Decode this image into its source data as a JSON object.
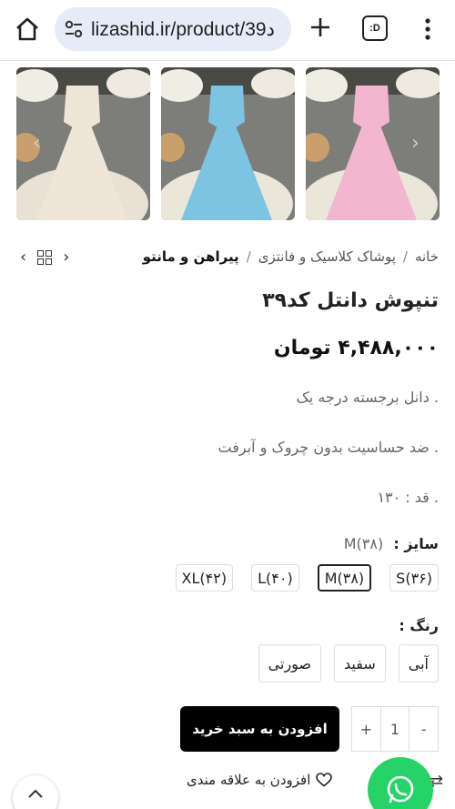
{
  "browser": {
    "url": "lizashid.ir/product/39د",
    "tabs_count_label": ":D"
  },
  "gallery": {
    "images": [
      {
        "alt": "cream-dress",
        "color": "#efe6d8"
      },
      {
        "alt": "blue-dress",
        "color": "#7cc4e2"
      },
      {
        "alt": "pink-dress",
        "color": "#f2b6cf"
      }
    ]
  },
  "breadcrumb": {
    "items": [
      "خانه",
      "پوشاک کلاسیک و فانتزی",
      "پیراهن و مانتو"
    ]
  },
  "product": {
    "title": "تنپوش دانتل کد۳۹",
    "price": "۴,۴۸۸,۰۰۰ تومان",
    "features": [
      ". دانل برجسته درجه یک",
      ". ضد حساسیت بدون چروک و آبرفت",
      ". قد : ۱۳۰"
    ],
    "size_label": "سایز :",
    "size_selected": "M(۳۸)",
    "sizes": [
      "S(۳۶)",
      "M(۳۸)",
      "L(۴۰)",
      "XL(۴۲)"
    ],
    "color_label": "رنگ :",
    "colors": [
      "آبی",
      "سفید",
      "صورتی"
    ],
    "quantity": "1",
    "qty_plus": "+",
    "qty_minus": "-",
    "add_to_cart": "افزودن به سبد خرید",
    "wishlist": "افزودن به علاقه مندی"
  }
}
